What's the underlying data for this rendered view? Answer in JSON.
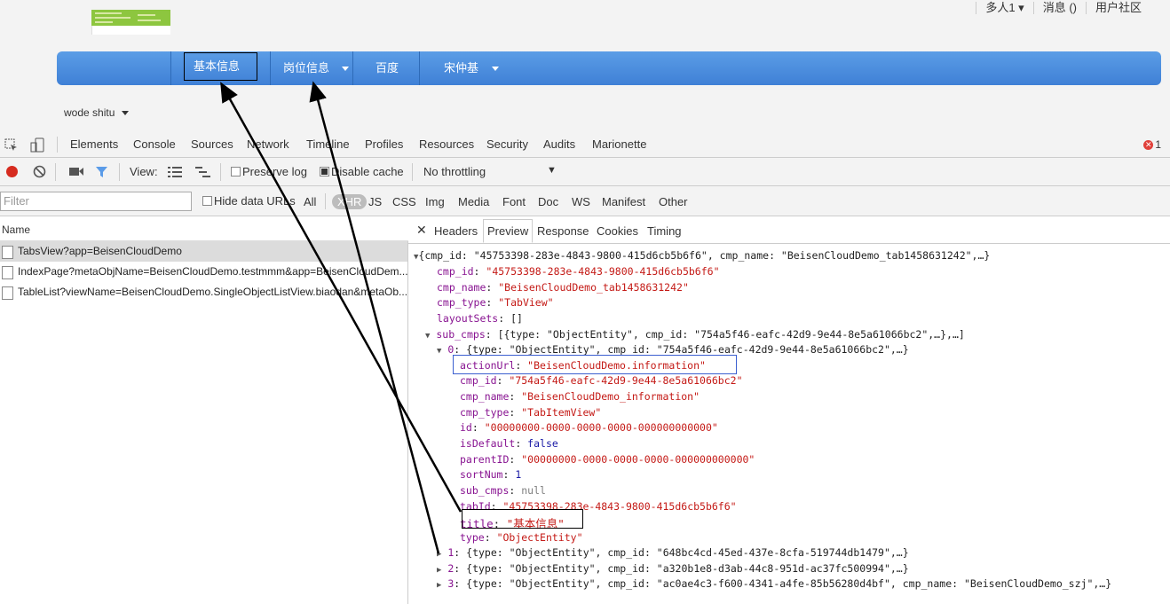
{
  "header": {
    "top_links": [
      "多人1 ▾",
      "消息 ()",
      "用户社区"
    ]
  },
  "nav": {
    "items": [
      "基本信息",
      "岗位信息",
      "百度",
      "宋仲基"
    ],
    "sub_item": "wode shitu"
  },
  "devtools": {
    "tabs": [
      "Elements",
      "Console",
      "Sources",
      "Network",
      "Timeline",
      "Profiles",
      "Resources",
      "Security",
      "Audits",
      "Marionette"
    ],
    "error_count": "1",
    "toolbar": {
      "view_label": "View:",
      "preserve_log": "Preserve log",
      "disable_cache": "Disable cache",
      "throttling": "No throttling"
    },
    "filter": {
      "placeholder": "Filter",
      "hide_data_urls": "Hide data URLs",
      "types": [
        "All",
        "XHR",
        "JS",
        "CSS",
        "Img",
        "Media",
        "Font",
        "Doc",
        "WS",
        "Manifest",
        "Other"
      ]
    },
    "name_header": "Name",
    "requests": [
      "TabsView?app=BeisenCloudDemo",
      "IndexPage?metaObjName=BeisenCloudDemo.testmmm&app=BeisenCloudDem...",
      "TableList?viewName=BeisenCloudDemo.SingleObjectListView.biaodan&metaOb..."
    ],
    "preview_tabs": [
      "Headers",
      "Preview",
      "Response",
      "Cookies",
      "Timing"
    ],
    "preview": {
      "root": "{cmp_id: \"45753398-283e-4843-9800-415d6cb5b6f6\", cmp_name: \"BeisenCloudDemo_tab1458631242\",…}",
      "cmp_id_key": "cmp_id",
      "cmp_id_val": "\"45753398-283e-4843-9800-415d6cb5b6f6\"",
      "cmp_name_key": "cmp_name",
      "cmp_name_val": "\"BeisenCloudDemo_tab1458631242\"",
      "cmp_type_key": "cmp_type",
      "cmp_type_val": "\"TabView\"",
      "layoutSets_key": "layoutSets",
      "layoutSets_val": "[]",
      "sub_cmps_key": "sub_cmps",
      "sub_cmps_val": "[{type: \"ObjectEntity\", cmp_id: \"754a5f46-eafc-42d9-9e44-8e5a61066bc2\",…},…]",
      "item0_key": "0",
      "item0_val": "{type: \"ObjectEntity\", cmp_id: \"754a5f46-eafc-42d9-9e44-8e5a61066bc2\",…}",
      "actionUrl_key": "actionUrl",
      "actionUrl_val": "\"BeisenCloudDemo.information\"",
      "c_cmp_id_key": "cmp_id",
      "c_cmp_id_val": "\"754a5f46-eafc-42d9-9e44-8e5a61066bc2\"",
      "c_cmp_name_key": "cmp_name",
      "c_cmp_name_val": "\"BeisenCloudDemo_information\"",
      "c_cmp_type_key": "cmp_type",
      "c_cmp_type_val": "\"TabItemView\"",
      "id_key": "id",
      "id_val": "\"00000000-0000-0000-0000-000000000000\"",
      "isDefault_key": "isDefault",
      "isDefault_val": "false",
      "parentID_key": "parentID",
      "parentID_val": "\"00000000-0000-0000-0000-000000000000\"",
      "sortNum_key": "sortNum",
      "sortNum_val": "1",
      "c_sub_cmps_key": "sub_cmps",
      "c_sub_cmps_val": "null",
      "tabId_key": "tabId",
      "tabId_val": "\"45753398-283e-4843-9800-415d6cb5b6f6\"",
      "title_key": "title",
      "title_val": "\"基本信息\"",
      "type_key": "type",
      "type_val": "\"ObjectEntity\"",
      "item1_key": "1",
      "item1_val": "{type: \"ObjectEntity\", cmp_id: \"648bc4cd-45ed-437e-8cfa-519744db1479\",…}",
      "item2_key": "2",
      "item2_val": "{type: \"ObjectEntity\", cmp_id: \"a320b1e8-d3ab-44c8-951d-ac37fc500994\",…}",
      "item3_key": "3",
      "item3_val": "{type: \"ObjectEntity\", cmp_id: \"ac0ae4c3-f600-4341-a4fe-85b56280d4bf\", cmp_name: \"BeisenCloudDemo_szj\",…}"
    }
  },
  "colors": {
    "navbar": "#4a8de0",
    "key": "#881391",
    "string": "#c41a16",
    "literal": "#1a1aa6"
  }
}
